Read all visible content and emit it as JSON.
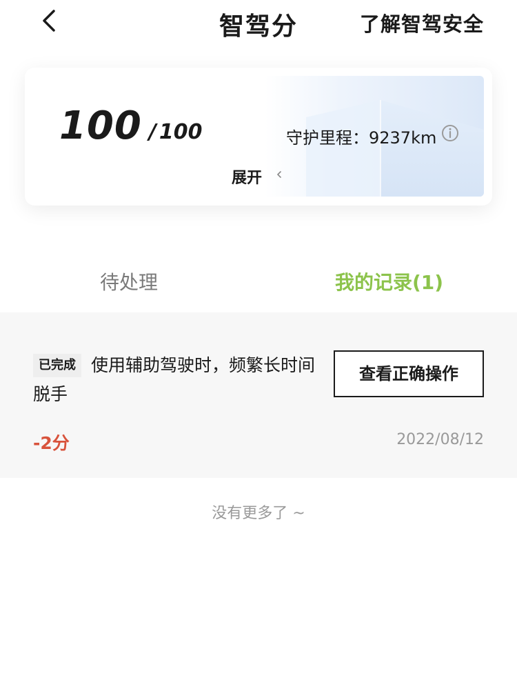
{
  "header": {
    "title": "智驾分",
    "link": "了解智驾安全",
    "back_icon": "chevron-left-icon"
  },
  "score_card": {
    "score": "100",
    "separator": "/",
    "total": "100",
    "mileage": "守护里程：9237km",
    "info_icon": "info-circle-icon",
    "expand_label": "展开",
    "expand_icon": "chevron-left-small-icon"
  },
  "tabs": [
    {
      "label": "待处理",
      "active": false
    },
    {
      "label": "我的记录(1)",
      "active": true
    }
  ],
  "records": [
    {
      "status": "已完成",
      "description": "使用辅助驾驶时，频繁长时间脱手",
      "action": "查看正确操作",
      "points": "-2分",
      "date": "2022/08/12"
    }
  ],
  "footer_text": "没有更多了 ~",
  "colors": {
    "accent_green": "#8cc34b",
    "penalty_red": "#d8533c",
    "muted_gray": "#999999"
  }
}
